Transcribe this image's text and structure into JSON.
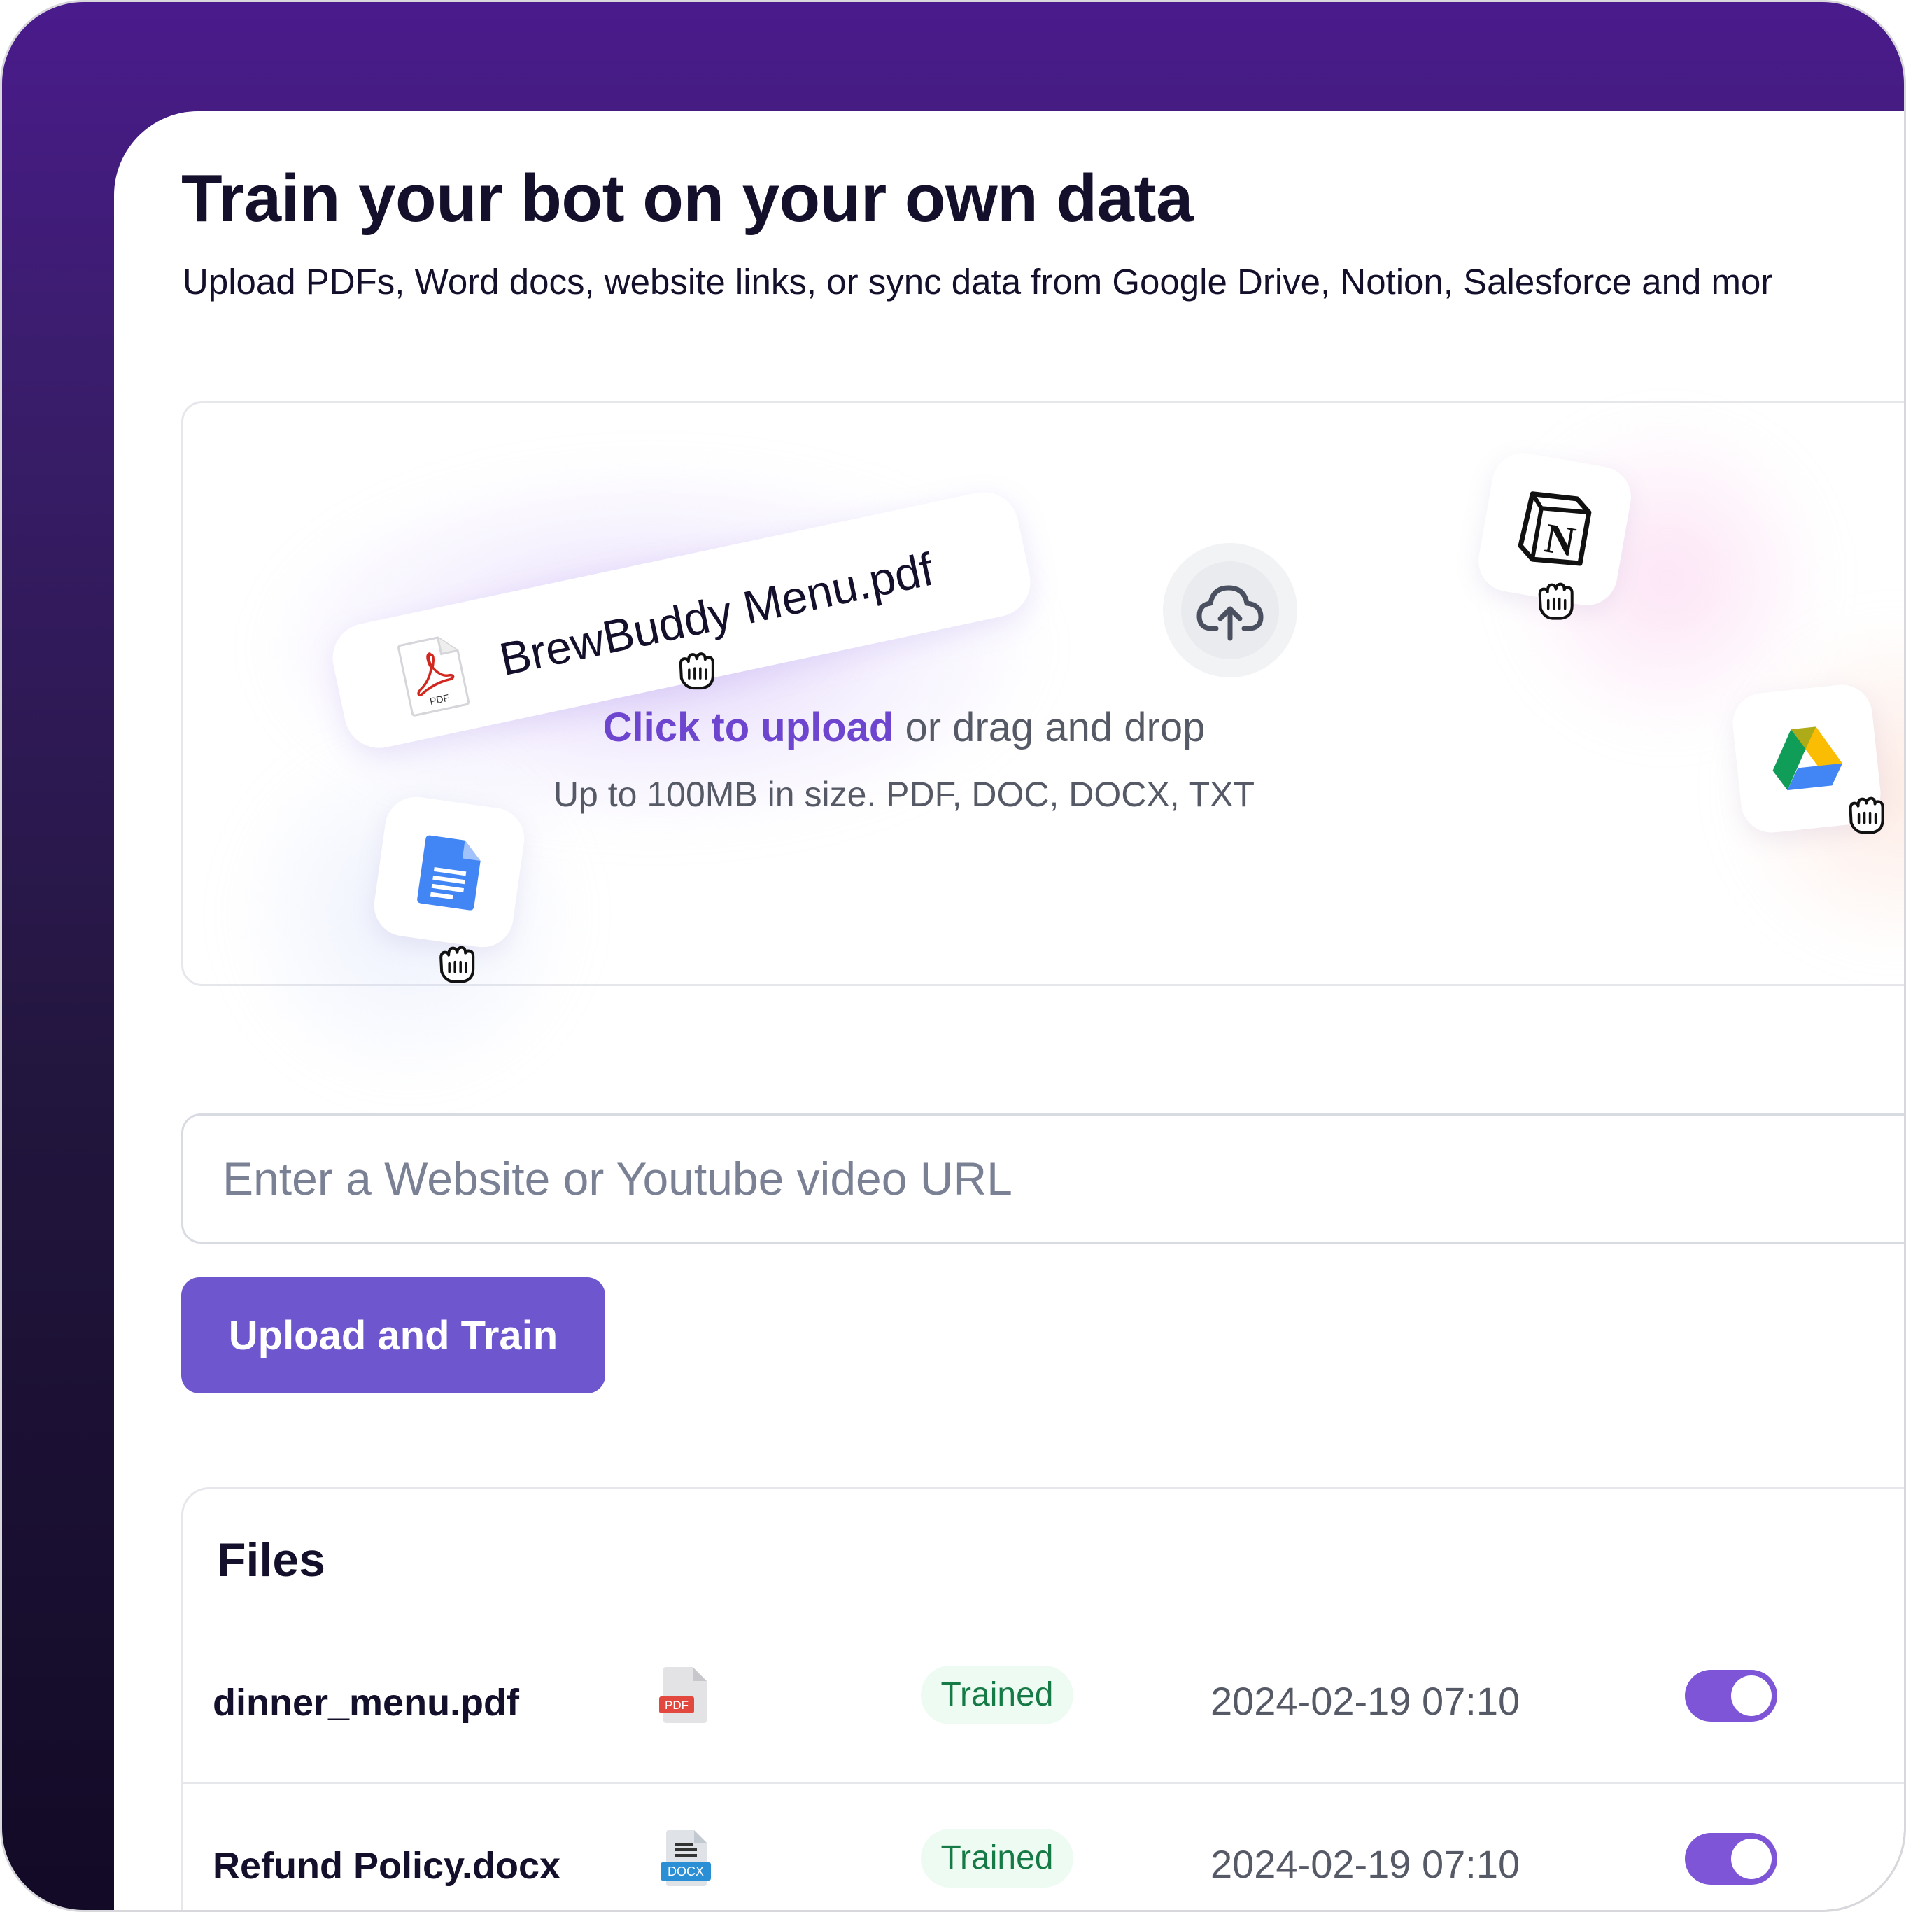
{
  "page": {
    "title": "Train your bot on your own data",
    "subtitle": "Upload PDFs, Word docs, website links, or sync data from Google Drive, Notion, Salesforce and mor"
  },
  "dropzone": {
    "sample_file": "BrewBuddy Menu.pdf",
    "pdf_tag": "PDF",
    "click_link": "Click to upload",
    "drag_text": " or drag and drop",
    "formats": "Up to 100MB in size. PDF, DOC, DOCX, TXT",
    "integrations": [
      "google-docs-icon",
      "notion-icon",
      "google-drive-icon"
    ],
    "notion_glyph": "N"
  },
  "url_input": {
    "placeholder": "Enter a Website or Youtube video URL",
    "value": ""
  },
  "actions": {
    "upload_train_label": "Upload and Train"
  },
  "files": {
    "title": "Files",
    "rows": [
      {
        "name": "dinner_menu.pdf",
        "type": "PDF",
        "icon": "pdf-file-icon",
        "status": "Trained",
        "date": "2024-02-19 07:10",
        "enabled": true
      },
      {
        "name": "Refund Policy.docx",
        "type": "DOCX",
        "icon": "docx-file-icon",
        "status": "Trained",
        "date": "2024-02-19 07:10",
        "enabled": true
      }
    ]
  },
  "colors": {
    "accent": "#6e56cf",
    "link": "#6d45cf",
    "toggle_on": "#7d55d6",
    "badge_bg": "#eefbf3",
    "badge_text": "#157a45",
    "frame_gradient_top": "#4a1b8c",
    "frame_gradient_bottom": "#120a26"
  }
}
